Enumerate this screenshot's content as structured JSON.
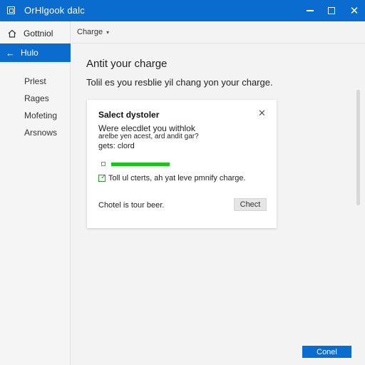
{
  "window": {
    "title": "OrHlgook dalc",
    "icon": "app-icon"
  },
  "sidebar": {
    "home_label": "Gottniol",
    "active_label": "Hulo",
    "items": [
      "Prlest",
      "Rages",
      "Mofeting",
      "Arsnows"
    ]
  },
  "main": {
    "breadcrumb": "Charge",
    "heading": "Antit your charge",
    "subtext": "Tolil es you resblie yil chang yon your charge."
  },
  "dialog": {
    "title": "Salect dystoler",
    "line1": "Were elecdlet you withlok",
    "line2": "arelbe yen acest, ard andit gar?",
    "line3": "gets: clord",
    "progress": 0.98,
    "checkbox_checked": true,
    "checkbox_label": "Toll ul cterts, ah yat leve pmnify charge.",
    "footer_text": "Chotel is tour beer.",
    "check_button": "Chect"
  },
  "footer": {
    "primary_button": "Conel"
  },
  "colors": {
    "accent": "#0a6ccf",
    "progress": "#1ec21e"
  }
}
